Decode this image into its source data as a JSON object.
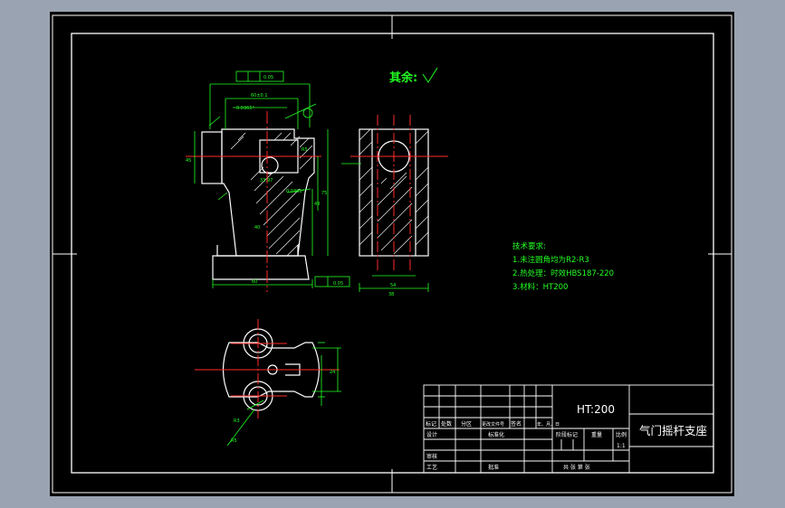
{
  "drawing": {
    "surface_text": "其余:",
    "tech_requirements": {
      "title": "技术要求:",
      "items": [
        "1.未注圆角均为R2-R3",
        "2.热处理：时效HBS187-220",
        "3.材料：HT200"
      ]
    },
    "title_block": {
      "material": "HT:200",
      "part_name": "气门摇杆支座",
      "headers": [
        "标记",
        "处数",
        "分区",
        "更改文件号",
        "签名",
        "年、月、日"
      ],
      "rows": [
        "设计",
        "审核",
        "工艺"
      ],
      "standardization": "标准化",
      "approval": "批准",
      "stage_labels": [
        "阶段标记",
        "重量",
        "比例"
      ],
      "scale": "1:1",
      "sheet": "共  张  第  张"
    },
    "dimensions": {
      "top_tolerance": "0.05",
      "bottom_tolerance": "0.05",
      "d1": "60±0.1",
      "d2": "0.0365°",
      "d3": "R5",
      "d4": "33.97",
      "d5": "0.0365°",
      "d6": "75",
      "d7": "48",
      "d8": "40",
      "d9": "60",
      "d10": "45",
      "d11": "54",
      "d12": "38",
      "d13": "24",
      "d14": "R3",
      "d15": "R5"
    }
  },
  "colors": {
    "background": "#9aa3b1",
    "canvas": "#000000",
    "frame": "#ffffff",
    "outline": "#ffffff",
    "dimension": "#22ff22",
    "centerline": "#ff2a2a",
    "text": "#22ff22"
  }
}
